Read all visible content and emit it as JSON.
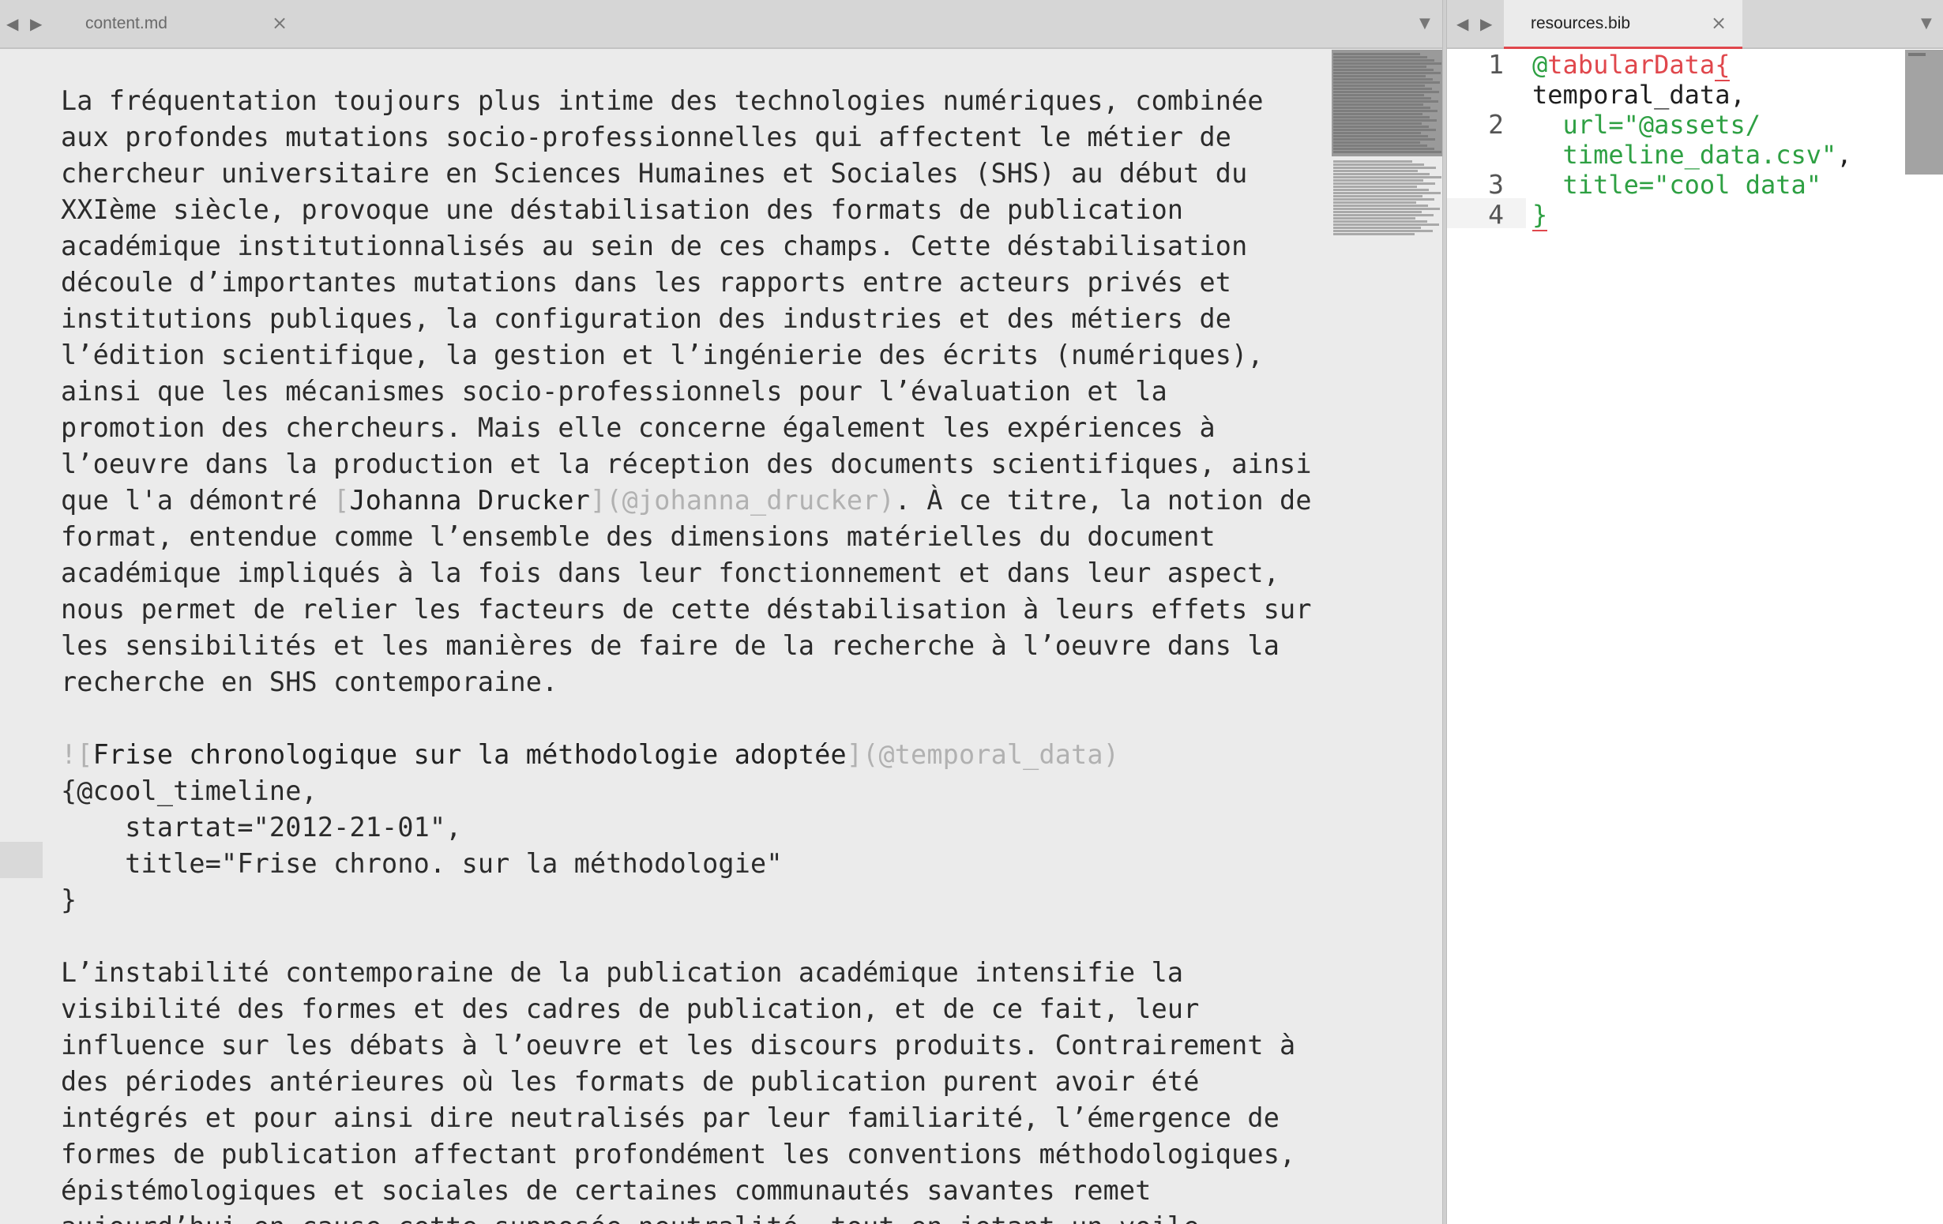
{
  "left_tabbar": {
    "back_arrow": "◀",
    "forward_arrow": "▶",
    "tab_label": "content.md",
    "close_glyph": "×",
    "dropdown_glyph": "▼"
  },
  "editor_left": {
    "p1": [
      "La fréquentation toujours plus intime des technologies numériques, combinée",
      "aux profondes mutations socio-professionnelles qui affectent le métier de",
      "chercheur universitaire en Sciences Humaines et Sociales (SHS) au début du",
      "XXIème siècle, provoque une déstabilisation des formats de publication",
      "académique institutionnalisés au sein de ces champs. Cette déstabilisation",
      "découle d’importantes mutations dans les rapports entre acteurs privés et",
      "institutions publiques, la configuration des industries et des métiers de",
      "l’édition scientifique, la gestion et l’ingénierie des écrits (numériques),",
      "ainsi que les mécanismes socio-professionnels pour l’évaluation et la",
      "promotion des chercheurs. Mais elle concerne également les expériences à",
      "l’oeuvre dans la production et la réception des documents scientifiques, ainsi"
    ],
    "p1_link_line": {
      "before": "que l'a démontré ",
      "open_bracket": "[",
      "link_text": "Johanna Drucker",
      "link_target": "](@johanna_drucker)",
      "after": ". À ce titre, la notion de"
    },
    "p1_rest": [
      "format, entendue comme l’ensemble des dimensions matérielles du document",
      "académique impliqués à la fois dans leur fonctionnement et dans leur aspect,",
      "nous permet de relier les facteurs de cette déstabilisation à leurs effets sur",
      "les sensibilités et les manières de faire de la recherche à l’oeuvre dans la",
      "recherche en SHS contemporaine."
    ],
    "image_line": {
      "prefix": "![",
      "alt": "Frise chronologique sur la méthodologie adoptée",
      "target": "](@temporal_data)"
    },
    "code_block": [
      "{@cool_timeline,",
      "    startat=\"2012-21-01\",",
      "    title=\"Frise chrono. sur la méthodologie\"",
      "}"
    ],
    "p2": [
      "L’instabilité contemporaine de la publication académique intensifie la",
      "visibilité des formes et des cadres de publication, et de ce fait, leur",
      "influence sur les débats à l’oeuvre et les discours produits. Contrairement à",
      "des périodes antérieures où les formats de publication purent avoir été",
      "intégrés et pour ainsi dire neutralisés par leur familiarité, l’émergence de",
      "formes de publication affectant profondément les conventions méthodologiques,",
      "épistémologiques et sociales de certaines communautés savantes remet",
      "aujourd’hui en cause cette supposée neutralité, tout en jetant un voile"
    ]
  },
  "right_tabbar": {
    "back_arrow": "◀",
    "forward_arrow": "▶",
    "tab_label": "resources.bib",
    "close_glyph": "×",
    "dropdown_glyph": "▼"
  },
  "editor_right": {
    "line_numbers": [
      "1",
      "2",
      "3",
      "4"
    ],
    "at": "@",
    "entry_type": "tabularData",
    "open_brace": "{",
    "key": "temporal_data,",
    "url_line1": "url=\"@assets/",
    "url_line2": "timeline_data.csv\"",
    "url_comma": ",",
    "title_line": "title=\"cool data\"",
    "close_brace": "}"
  },
  "colors": {
    "accent_red": "#e0474c",
    "string_green": "#2ea043",
    "muted_markup": "#b1b1b1"
  }
}
